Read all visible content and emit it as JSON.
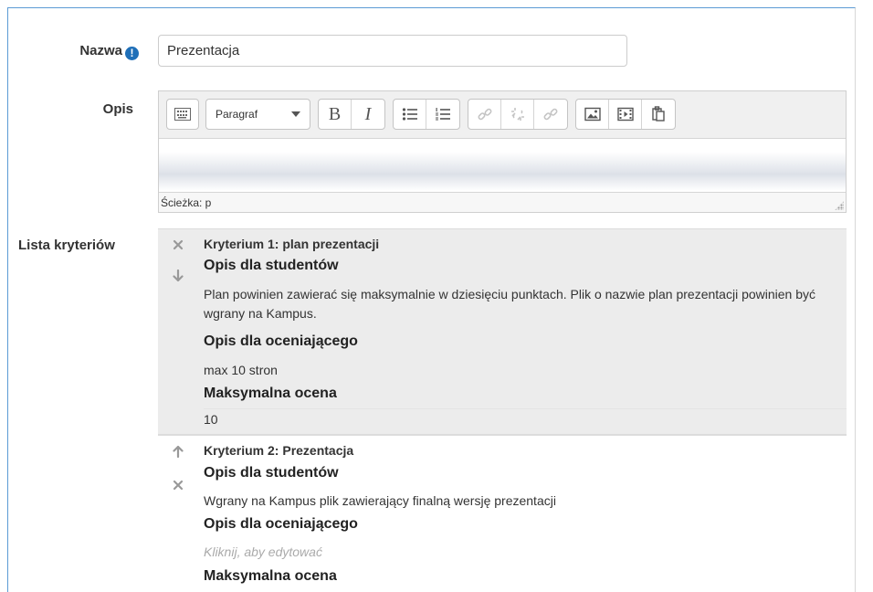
{
  "form": {
    "name_label": "Nazwa",
    "required_icon": "!",
    "name_value": "Prezentacja",
    "description_label": "Opis",
    "criteria_label": "Lista kryteriów"
  },
  "editor": {
    "paragraph_select": "Paragraf",
    "bold": "B",
    "italic": "I",
    "path": "Ścieżka: p"
  },
  "criteria": [
    {
      "title": "Kryterium 1: plan prezentacji",
      "student_heading": "Opis dla studentów",
      "student_text": "Plan powinien zawierać się maksymalnie w dziesięciu punktach. Plik o nazwie plan prezentacji powinien być wgrany na Kampus.",
      "grader_heading": "Opis dla oceniającego",
      "grader_text": "max 10 stron",
      "max_heading": "Maksymalna ocena",
      "max_value": "10"
    },
    {
      "title": "Kryterium 2: Prezentacja",
      "student_heading": "Opis dla studentów",
      "student_text": "Wgrany na Kampus plik zawierający finalną wersję prezentacji",
      "grader_heading": "Opis dla oceniającego",
      "grader_placeholder": "Kliknij, aby edytować",
      "max_heading": "Maksymalna ocena"
    }
  ],
  "colors": {
    "accent": "#1f6fb8",
    "frame": "#5b9bd5",
    "criterion_bg": "#ececec"
  }
}
